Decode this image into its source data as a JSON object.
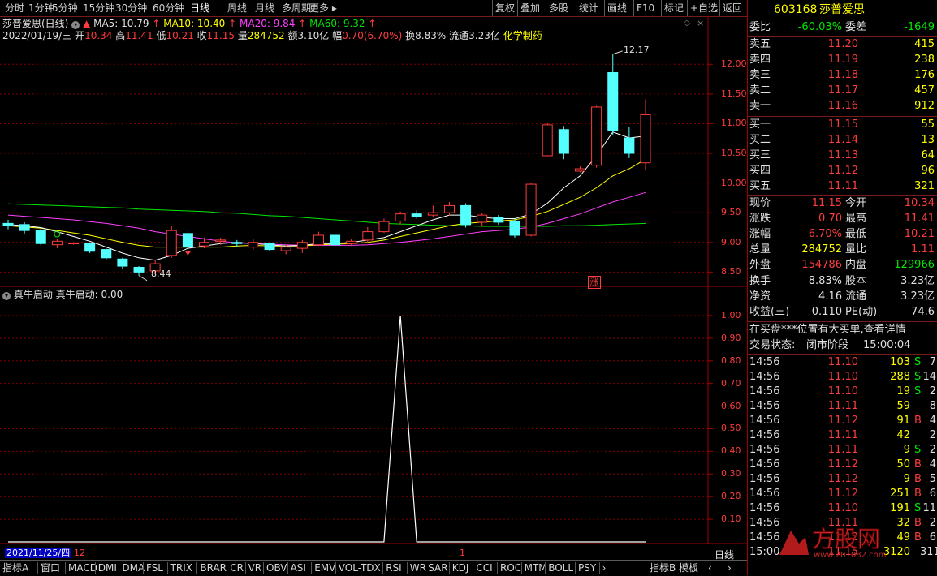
{
  "toolbar": {
    "periods": [
      "分时",
      "1分钟",
      "5分钟",
      "15分钟",
      "30分钟",
      "60分钟",
      "日线",
      "周线",
      "月线",
      "多周期",
      "更多"
    ],
    "active": "日线",
    "actions": [
      "复权",
      "叠加",
      "多股",
      "统计",
      "画线",
      "F10",
      "标记",
      "+自选",
      "返回"
    ]
  },
  "chart_header": {
    "name": "莎普爱思(日线)",
    "ma5": "MA5: 10.79",
    "ma10": "MA10: 10.40",
    "ma20": "MA20: 9.84",
    "ma60": "MA60: 9.32",
    "date": "2022/01/19/三",
    "open_label": "开",
    "open": "10.34",
    "high_label": "高",
    "high": "11.41",
    "low_label": "低",
    "low": "10.21",
    "close_label": "收",
    "close": "11.15",
    "vol_label": "量",
    "vol": "284752",
    "amt_label": "额",
    "amt": "3.10亿",
    "chg_label": "幅",
    "chg": "0.70(6.70%)",
    "turn_label": "换",
    "turn": "8.83%",
    "float_label": "流通",
    "float": "3.23亿",
    "sector": "化学制药"
  },
  "price_axis": [
    "12.00",
    "11.50",
    "11.00",
    "10.50",
    "10.00",
    "9.50",
    "9.00",
    "8.50"
  ],
  "annotations": {
    "high_mark": "12.17",
    "low_mark": "8.44",
    "zhang_badge": "涨"
  },
  "indicator": {
    "title": "真牛启动",
    "value_label": "真牛启动: 0.00",
    "axis": [
      "1.00",
      "0.90",
      "0.80",
      "0.70",
      "0.60",
      "0.50",
      "0.40",
      "0.30",
      "0.20",
      "0.10"
    ]
  },
  "date_cursor": {
    "date": "2021/11/25/四",
    "month": "12",
    "mark": "1"
  },
  "period_label": "日线",
  "bottom_tabs": [
    "指标A",
    "窗口",
    "MACD",
    "DMI",
    "DMA",
    "FSL",
    "TRIX",
    "BRAR",
    "CR",
    "VR",
    "OBV",
    "ASI",
    "EMV",
    "VOL-TDX",
    "RSI",
    "WR",
    "SAR",
    "KDJ",
    "CCI",
    "ROC",
    "MTM",
    "BOLL",
    "PSY"
  ],
  "bottom_right": [
    "指标B",
    "模板"
  ],
  "quote": {
    "code": "603168",
    "name": "莎普爱思",
    "weibi_label": "委比",
    "weibi": "-60.03%",
    "weicha_label": "委差",
    "weicha": "-1649",
    "asks": [
      {
        "label": "卖五",
        "price": "11.20",
        "vol": "415"
      },
      {
        "label": "卖四",
        "price": "11.19",
        "vol": "238"
      },
      {
        "label": "卖三",
        "price": "11.18",
        "vol": "176"
      },
      {
        "label": "卖二",
        "price": "11.17",
        "vol": "457"
      },
      {
        "label": "卖一",
        "price": "11.16",
        "vol": "912"
      }
    ],
    "bids": [
      {
        "label": "买一",
        "price": "11.15",
        "vol": "55"
      },
      {
        "label": "买二",
        "price": "11.14",
        "vol": "13"
      },
      {
        "label": "买三",
        "price": "11.13",
        "vol": "64"
      },
      {
        "label": "买四",
        "price": "11.12",
        "vol": "96"
      },
      {
        "label": "买五",
        "price": "11.11",
        "vol": "321"
      }
    ],
    "stats": [
      {
        "l1": "现价",
        "v1": "11.15",
        "c1": "red",
        "l2": "今开",
        "v2": "10.34",
        "c2": "red"
      },
      {
        "l1": "涨跌",
        "v1": "0.70",
        "c1": "red",
        "l2": "最高",
        "v2": "11.41",
        "c2": "red"
      },
      {
        "l1": "涨幅",
        "v1": "6.70%",
        "c1": "red",
        "l2": "最低",
        "v2": "10.21",
        "c2": "red"
      },
      {
        "l1": "总量",
        "v1": "284752",
        "c1": "yel",
        "l2": "量比",
        "v2": "1.11",
        "c2": "red"
      },
      {
        "l1": "外盘",
        "v1": "154786",
        "c1": "red",
        "l2": "内盘",
        "v2": "129966",
        "c2": "green"
      }
    ],
    "stats2": [
      {
        "l1": "换手",
        "v1": "8.83%",
        "l2": "股本",
        "v2": "3.23亿"
      },
      {
        "l1": "净资",
        "v1": "4.16",
        "l2": "流通",
        "v2": "3.23亿"
      },
      {
        "l1": "收益(三)",
        "v1": "0.110",
        "l2": "PE(动)",
        "v2": "74.6"
      }
    ],
    "notice": "在买盘***位置有大买单,查看详情",
    "status_label": "交易状态:",
    "status": "闭市阶段",
    "status_time": "15:00:04",
    "ticks": [
      {
        "t": "14:56",
        "p": "11.10",
        "v": "103",
        "s": "S",
        "n": "7"
      },
      {
        "t": "14:56",
        "p": "11.10",
        "v": "288",
        "s": "S",
        "n": "14"
      },
      {
        "t": "14:56",
        "p": "11.10",
        "v": "19",
        "s": "S",
        "n": "2"
      },
      {
        "t": "14:56",
        "p": "11.11",
        "v": "59",
        "s": "",
        "n": "8"
      },
      {
        "t": "14:56",
        "p": "11.12",
        "v": "91",
        "s": "B",
        "n": "4"
      },
      {
        "t": "14:56",
        "p": "11.11",
        "v": "42",
        "s": "",
        "n": "2"
      },
      {
        "t": "14:56",
        "p": "11.11",
        "v": "9",
        "s": "S",
        "n": "2"
      },
      {
        "t": "14:56",
        "p": "11.12",
        "v": "50",
        "s": "B",
        "n": "4"
      },
      {
        "t": "14:56",
        "p": "11.12",
        "v": "9",
        "s": "B",
        "n": "5"
      },
      {
        "t": "14:56",
        "p": "11.12",
        "v": "251",
        "s": "B",
        "n": "6"
      },
      {
        "t": "14:56",
        "p": "11.10",
        "v": "191",
        "s": "S",
        "n": "11"
      },
      {
        "t": "14:56",
        "p": "11.11",
        "v": "32",
        "s": "B",
        "n": "2"
      },
      {
        "t": "14:56",
        "p": "11.12",
        "v": "49",
        "s": "B",
        "n": "6"
      },
      {
        "t": "15:00",
        "p": "11.15",
        "v": "3120",
        "s": "",
        "n": "311"
      }
    ]
  },
  "colors": {
    "up": "#ff3c3c",
    "down": "#54ffff",
    "ma5": "#ffffff",
    "ma10": "#ffff00",
    "ma20": "#ff40ff",
    "ma60": "#00e600",
    "border": "#a00000"
  },
  "chart_data": {
    "type": "candlestick",
    "ylim": [
      8.3,
      12.4
    ],
    "candles": [
      {
        "o": 9.32,
        "c": 9.28,
        "h": 9.38,
        "l": 9.22
      },
      {
        "o": 9.3,
        "c": 9.2,
        "h": 9.34,
        "l": 9.15
      },
      {
        "o": 9.2,
        "c": 8.98,
        "h": 9.24,
        "l": 8.95
      },
      {
        "o": 8.96,
        "c": 9.02,
        "h": 9.06,
        "l": 8.9
      },
      {
        "o": 8.98,
        "c": 8.99,
        "h": 9.0,
        "l": 8.96
      },
      {
        "o": 8.98,
        "c": 8.85,
        "h": 9.0,
        "l": 8.82
      },
      {
        "o": 8.88,
        "c": 8.74,
        "h": 8.9,
        "l": 8.7
      },
      {
        "o": 8.72,
        "c": 8.6,
        "h": 8.74,
        "l": 8.56
      },
      {
        "o": 8.58,
        "c": 8.5,
        "h": 8.6,
        "l": 8.44
      },
      {
        "o": 8.52,
        "c": 8.64,
        "h": 8.7,
        "l": 8.46
      },
      {
        "o": 8.78,
        "c": 9.2,
        "h": 9.28,
        "l": 8.74
      },
      {
        "o": 9.15,
        "c": 8.92,
        "h": 9.2,
        "l": 8.88
      },
      {
        "o": 8.94,
        "c": 9.0,
        "h": 9.08,
        "l": 8.9
      },
      {
        "o": 9.02,
        "c": 9.04,
        "h": 9.08,
        "l": 8.96
      },
      {
        "o": 9.0,
        "c": 8.98,
        "h": 9.04,
        "l": 8.92
      },
      {
        "o": 8.92,
        "c": 9.0,
        "h": 9.05,
        "l": 8.88
      },
      {
        "o": 8.98,
        "c": 8.88,
        "h": 9.0,
        "l": 8.86
      },
      {
        "o": 8.86,
        "c": 8.92,
        "h": 8.96,
        "l": 8.8
      },
      {
        "o": 8.9,
        "c": 9.0,
        "h": 9.04,
        "l": 8.82
      },
      {
        "o": 8.96,
        "c": 9.12,
        "h": 9.18,
        "l": 8.94
      },
      {
        "o": 9.12,
        "c": 8.96,
        "h": 9.14,
        "l": 8.92
      },
      {
        "o": 8.98,
        "c": 9.02,
        "h": 9.06,
        "l": 8.94
      },
      {
        "o": 9.04,
        "c": 9.18,
        "h": 9.26,
        "l": 9.0
      },
      {
        "o": 9.18,
        "c": 9.35,
        "h": 9.4,
        "l": 9.16
      },
      {
        "o": 9.36,
        "c": 9.48,
        "h": 9.52,
        "l": 9.3
      },
      {
        "o": 9.48,
        "c": 9.44,
        "h": 9.54,
        "l": 9.4
      },
      {
        "o": 9.46,
        "c": 9.5,
        "h": 9.62,
        "l": 9.42
      },
      {
        "o": 9.5,
        "c": 9.62,
        "h": 9.68,
        "l": 9.45
      },
      {
        "o": 9.62,
        "c": 9.3,
        "h": 9.66,
        "l": 9.25
      },
      {
        "o": 9.34,
        "c": 9.46,
        "h": 9.5,
        "l": 9.28
      },
      {
        "o": 9.42,
        "c": 9.34,
        "h": 9.46,
        "l": 9.3
      },
      {
        "o": 9.36,
        "c": 9.12,
        "h": 9.4,
        "l": 9.08
      },
      {
        "o": 9.12,
        "c": 9.98,
        "h": 10.0,
        "l": 9.1
      },
      {
        "o": 10.46,
        "c": 10.98,
        "h": 11.02,
        "l": 10.45
      },
      {
        "o": 10.9,
        "c": 10.5,
        "h": 10.96,
        "l": 10.4
      },
      {
        "o": 10.2,
        "c": 10.24,
        "h": 10.28,
        "l": 10.18
      },
      {
        "o": 10.3,
        "c": 11.28,
        "h": 11.3,
        "l": 10.26
      },
      {
        "o": 11.86,
        "c": 10.88,
        "h": 12.17,
        "l": 10.8
      },
      {
        "o": 10.76,
        "c": 10.5,
        "h": 10.94,
        "l": 10.42
      },
      {
        "o": 10.34,
        "c": 11.15,
        "h": 11.41,
        "l": 10.21
      }
    ],
    "ma5": [
      9.3,
      9.28,
      9.25,
      9.18,
      9.1,
      9.02,
      8.92,
      8.82,
      8.74,
      8.7,
      8.78,
      8.9,
      8.94,
      8.98,
      9.0,
      8.98,
      8.96,
      8.94,
      8.95,
      8.98,
      8.98,
      9.0,
      9.04,
      9.08,
      9.18,
      9.28,
      9.38,
      9.46,
      9.46,
      9.42,
      9.4,
      9.4,
      9.48,
      9.66,
      9.92,
      10.12,
      10.46,
      10.86,
      10.76,
      10.79
    ],
    "ma10": [
      9.28,
      9.26,
      9.24,
      9.2,
      9.16,
      9.12,
      9.06,
      9.0,
      8.95,
      8.92,
      8.92,
      8.92,
      8.92,
      8.92,
      8.94,
      8.95,
      8.94,
      8.94,
      8.94,
      8.96,
      8.97,
      8.98,
      9.0,
      9.04,
      9.1,
      9.16,
      9.22,
      9.28,
      9.32,
      9.34,
      9.36,
      9.38,
      9.44,
      9.52,
      9.64,
      9.76,
      9.92,
      10.12,
      10.24,
      10.4
    ],
    "ma20": [
      9.46,
      9.44,
      9.42,
      9.4,
      9.38,
      9.35,
      9.32,
      9.28,
      9.24,
      9.18,
      9.14,
      9.1,
      9.06,
      9.02,
      8.99,
      8.98,
      8.97,
      8.96,
      8.95,
      8.95,
      8.95,
      8.95,
      8.96,
      8.98,
      9.0,
      9.03,
      9.06,
      9.1,
      9.14,
      9.18,
      9.2,
      9.22,
      9.26,
      9.32,
      9.4,
      9.48,
      9.58,
      9.68,
      9.76,
      9.84
    ],
    "ma60": [
      9.65,
      9.64,
      9.63,
      9.62,
      9.61,
      9.6,
      9.59,
      9.58,
      9.56,
      9.55,
      9.54,
      9.53,
      9.52,
      9.5,
      9.49,
      9.47,
      9.45,
      9.44,
      9.42,
      9.4,
      9.38,
      9.36,
      9.34,
      9.32,
      9.31,
      9.3,
      9.29,
      9.28,
      9.28,
      9.27,
      9.27,
      9.27,
      9.27,
      9.27,
      9.28,
      9.28,
      9.29,
      9.3,
      9.31,
      9.32
    ],
    "indicator_values": [
      0,
      0,
      0,
      0,
      0,
      0,
      0,
      0,
      0,
      0,
      0,
      0,
      0,
      0,
      0,
      0,
      0,
      0,
      0,
      0,
      0,
      0,
      0,
      0,
      1,
      0,
      0,
      0,
      0,
      0,
      0,
      0,
      0,
      0,
      0,
      0,
      0,
      0,
      0,
      0
    ],
    "indicator_ylim": [
      0,
      1.05
    ]
  }
}
